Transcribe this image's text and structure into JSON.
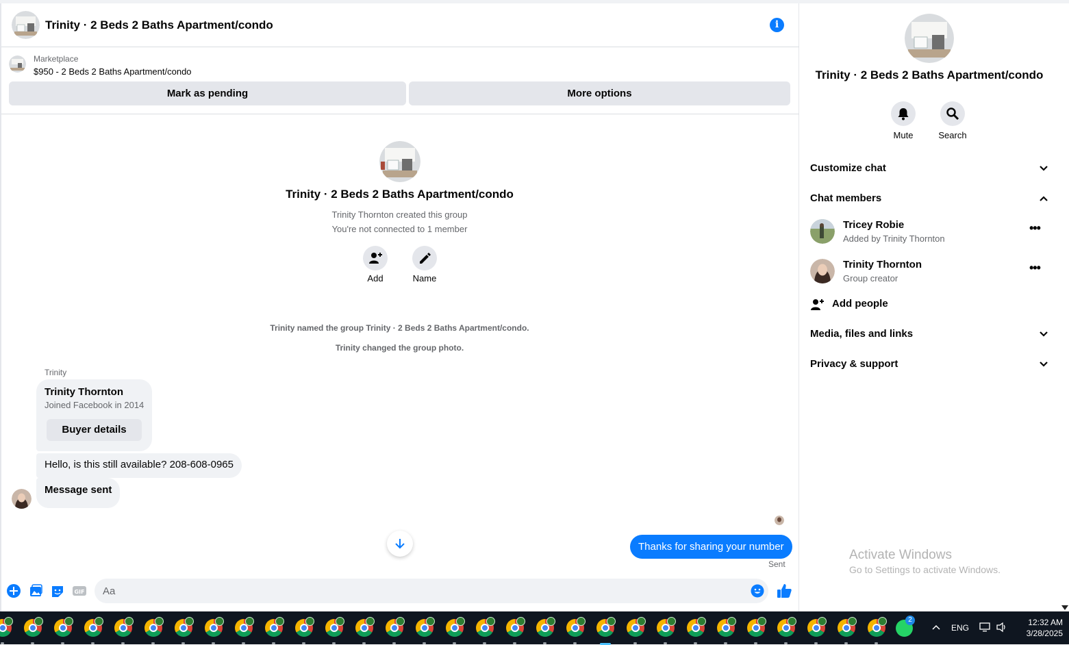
{
  "header": {
    "title": "Trinity · 2 Beds 2 Baths Apartment/condo"
  },
  "listing": {
    "source": "Marketplace",
    "title": "$950 - 2 Beds 2 Baths Apartment/condo",
    "mark_pending_label": "Mark as pending",
    "more_options_label": "More options"
  },
  "intro": {
    "title": "Trinity · 2 Beds 2 Baths Apartment/condo",
    "created_by": "Trinity Thornton created this group",
    "connection": "You're not connected to 1 member",
    "add_label": "Add",
    "name_label": "Name"
  },
  "system_notes": [
    "Trinity named the group Trinity · 2 Beds 2 Baths Apartment/condo.",
    "Trinity changed the group photo."
  ],
  "messages": {
    "sender": "Trinity",
    "card_name": "Trinity Thornton",
    "card_sub": "Joined Facebook in 2014",
    "card_button": "Buyer details",
    "incoming": [
      "Hello, is this still available? 208-608-0965",
      "Message sent"
    ],
    "outgoing": "Thanks for sharing your number",
    "status": "Sent"
  },
  "composer": {
    "placeholder": "Aa"
  },
  "side": {
    "title": "Trinity · 2 Beds 2 Baths Apartment/condo",
    "mute_label": "Mute",
    "search_label": "Search",
    "sections": {
      "customize": "Customize chat",
      "members": "Chat members",
      "media": "Media, files and links",
      "privacy": "Privacy & support"
    },
    "members_list": [
      {
        "name": "Tricey Robie",
        "sub": "Added by Trinity Thornton"
      },
      {
        "name": "Trinity Thornton",
        "sub": "Group creator"
      }
    ],
    "add_people": "Add people"
  },
  "watermark": {
    "line1": "Activate Windows",
    "line2": "Go to Settings to activate Windows."
  },
  "taskbar": {
    "whatsapp_badge": "2",
    "lang": "ENG",
    "time": "12:32 AM",
    "date": "3/28/2025"
  },
  "colors": {
    "accent": "#0a7cff",
    "bubble": "#f0f2f5",
    "button": "#e4e6eb",
    "taskbar": "#0f1620"
  }
}
